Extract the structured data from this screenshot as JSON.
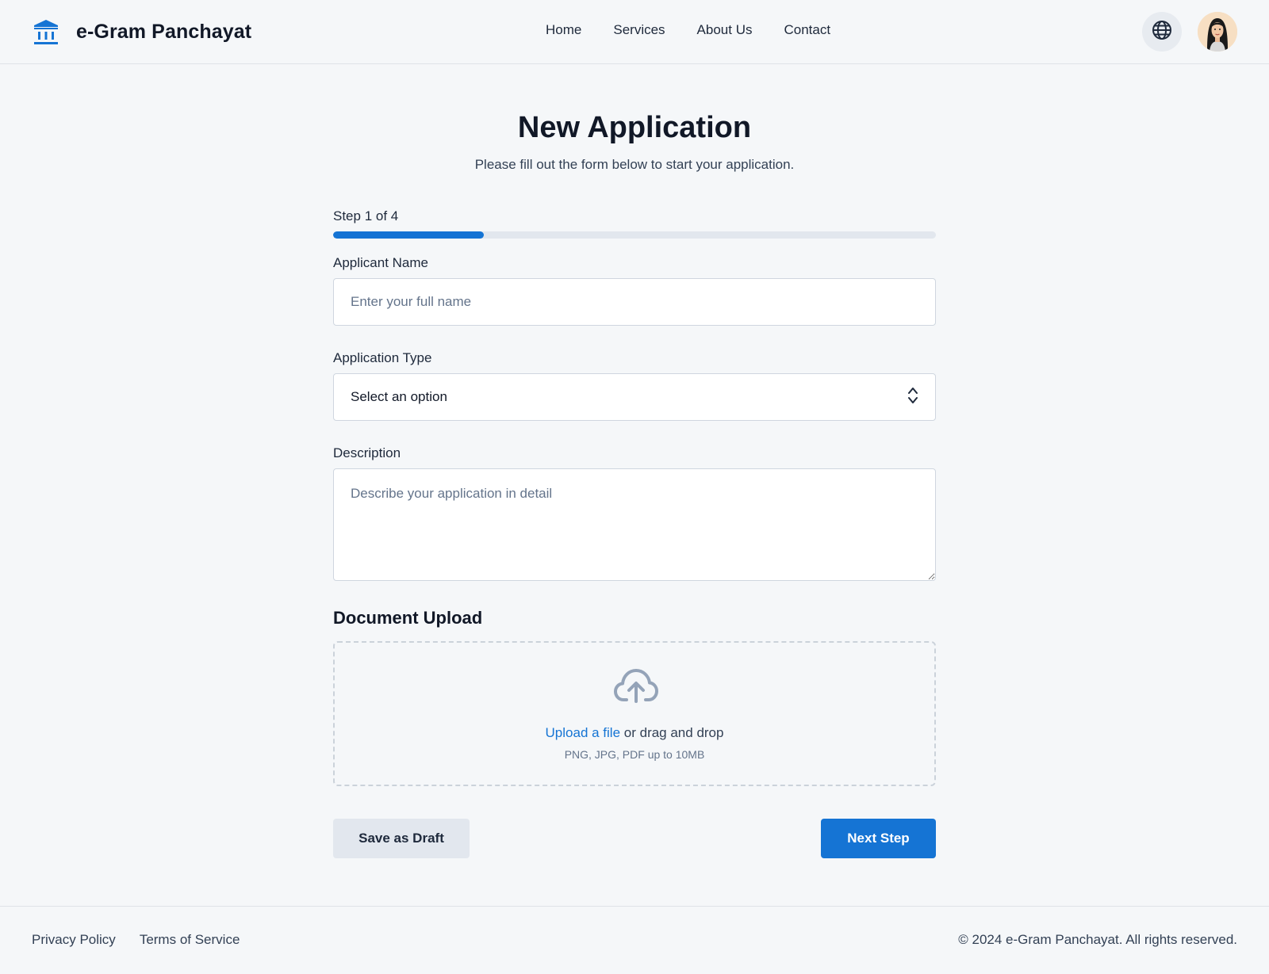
{
  "header": {
    "brand_title": "e-Gram Panchayat",
    "brand_icon": "government-building-icon",
    "nav": [
      "Home",
      "Services",
      "About Us",
      "Contact"
    ],
    "language_icon": "globe-icon",
    "avatar_icon": "user-avatar"
  },
  "main": {
    "title": "New Application",
    "subtitle": "Please fill out the form below to start your application.",
    "step_label": "Step 1 of 4",
    "progress": {
      "current": 1,
      "total": 4,
      "fraction": 0.25
    },
    "fields": {
      "name": {
        "label": "Applicant Name",
        "placeholder": "Enter your full name",
        "value": ""
      },
      "type": {
        "label": "Application Type",
        "value": "Select an option",
        "icon": "chevron-up-down-icon"
      },
      "description": {
        "label": "Description",
        "placeholder": "Describe your application in detail",
        "value": ""
      }
    },
    "upload": {
      "heading": "Document Upload",
      "icon": "cloud-upload-icon",
      "link": "Upload a file",
      "text": " or drag and drop",
      "hint": "PNG, JPG, PDF up to 10MB"
    },
    "buttons": {
      "draft": "Save as Draft",
      "next": "Next Step"
    }
  },
  "footer": {
    "links": [
      "Privacy Policy",
      "Terms of Service"
    ],
    "copyright": "© 2024 e-Gram Panchayat. All rights reserved."
  },
  "colors": {
    "accent": "#1574d4",
    "background": "#f5f7f9",
    "text": "#111827"
  }
}
